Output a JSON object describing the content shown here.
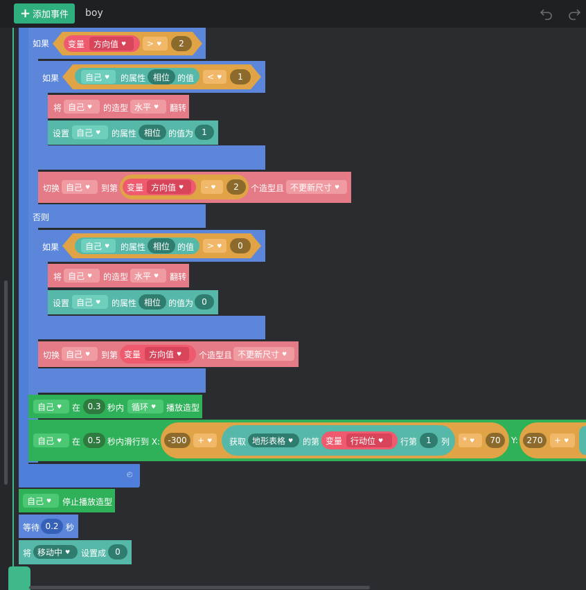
{
  "toolbar": {
    "add_event": "添加事件",
    "sprite_tab": "boy"
  },
  "blocks": {
    "if": "如果",
    "else": "否则",
    "var": "变量",
    "var_dir": "方向值",
    "var_move": "行动位",
    "self": "自己",
    "prop_of": "的属性",
    "prop_val": "的值",
    "phase": "相位",
    "set": "设置",
    "set_to": "的值为",
    "flip_prefix": "将",
    "costume_of": "的造型",
    "horizontal": "水平",
    "flip": "翻转",
    "switch": "切换",
    "to_nth": "到第",
    "costume_and": "个造型且",
    "no_resize": "不更新尺寸",
    "op_gt": ">",
    "op_lt": "<",
    "op_minus": "-",
    "op_plus": "+",
    "op_times": "*",
    "n2": "2",
    "n1": "1",
    "n0": "0",
    "at": "在",
    "within": "秒内",
    "loop": "循环",
    "play_costume": "播放造型",
    "sec03": "0.3",
    "sec05": "0.5",
    "glide_to": "秒内滑行到 X:",
    "x_base": "-300",
    "get": "获取",
    "grid_table": "地形表格",
    "nth": "的第",
    "row_nth": "行第",
    "col": "列",
    "n70": "70",
    "y_label": "Y:",
    "y_base": "270",
    "stop_costume": "停止播放造型",
    "wait": "等待",
    "wait_val": "0.2",
    "sec": "秒",
    "moving": "移动中",
    "set_as": "设置成"
  }
}
